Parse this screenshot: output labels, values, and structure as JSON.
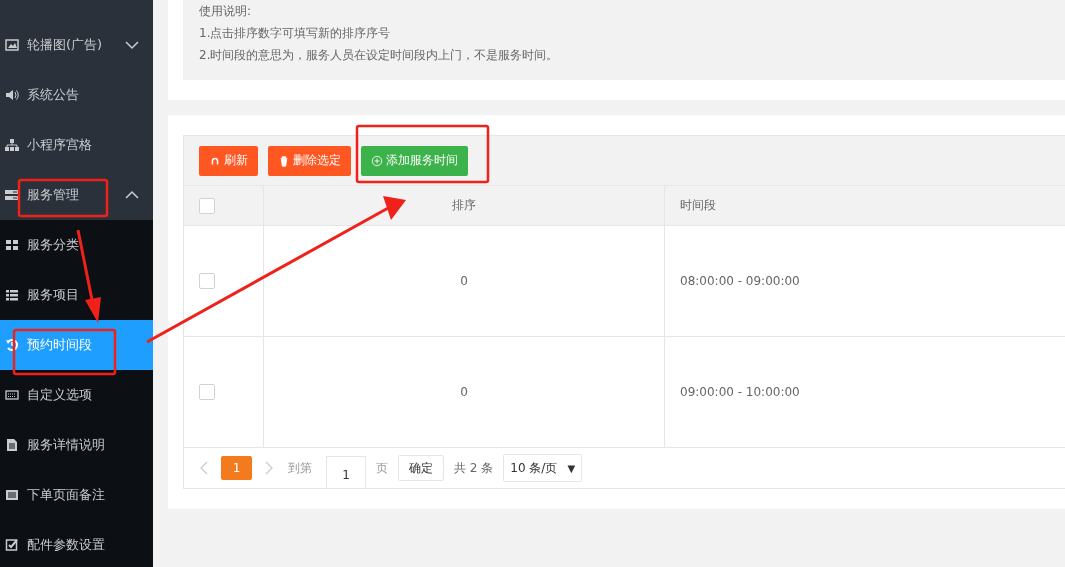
{
  "sidebar": {
    "items": [
      {
        "label": "轮播图(广告)",
        "kind": "group",
        "expanded": false,
        "selected": false
      },
      {
        "label": "系统公告",
        "kind": "link",
        "selected": false
      },
      {
        "label": "小程序宫格",
        "kind": "link",
        "selected": false
      },
      {
        "label": "服务管理",
        "kind": "group",
        "expanded": true,
        "selected": false,
        "children": [
          {
            "label": "服务分类",
            "selected": false
          },
          {
            "label": "服务项目",
            "selected": false
          },
          {
            "label": "预约时间段",
            "selected": true
          },
          {
            "label": "自定义选项",
            "selected": false
          },
          {
            "label": "服务详情说明",
            "selected": false
          },
          {
            "label": "下单页面备注",
            "selected": false
          },
          {
            "label": "配件参数设置",
            "selected": false
          }
        ]
      }
    ]
  },
  "notice": {
    "lines": [
      "使用说明:",
      "1.点击排序数字可填写新的排序序号",
      "2.时间段的意思为，服务人员在设定时间段内上门，不是服务时间。"
    ]
  },
  "toolbar": {
    "buttons": [
      {
        "label": "刷新",
        "kind": "warm"
      },
      {
        "label": "删除选定",
        "kind": "warm"
      },
      {
        "label": "添加服务时间",
        "kind": "normal"
      }
    ]
  },
  "table": {
    "header_checked": false,
    "columns": [
      "排序",
      "时间段"
    ],
    "rows": [
      {
        "checked": false,
        "cells": [
          "0",
          "08:00:00 - 09:00:00"
        ]
      },
      {
        "checked": false,
        "cells": [
          "0",
          "09:00:00 - 10:00:00"
        ]
      }
    ]
  },
  "pagination": {
    "pages": [
      {
        "label": "1",
        "selected": true
      }
    ],
    "goto_label": "到第",
    "goto_value": "1",
    "page_suffix": "页",
    "confirm": "确定",
    "total": "共 2 条",
    "page_size": "10 条/页",
    "page_size_caret": "▼"
  }
}
